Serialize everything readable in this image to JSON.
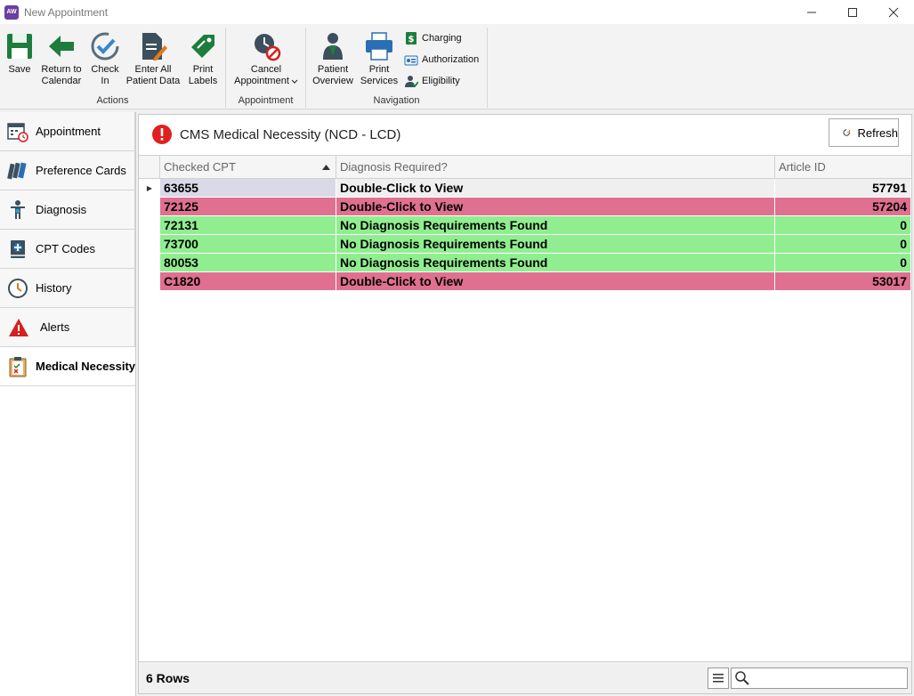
{
  "window": {
    "title": "New Appointment",
    "logo_text": "AW"
  },
  "ribbon": {
    "actions": {
      "label": "Actions",
      "save": "Save",
      "return_line1": "Return to",
      "return_line2": "Calendar",
      "checkin_line1": "Check",
      "checkin_line2": "In",
      "enter_line1": "Enter All",
      "enter_line2": "Patient Data",
      "print_line1": "Print",
      "print_line2": "Labels"
    },
    "appointment": {
      "label": "Appointment",
      "cancel_line1": "Cancel",
      "cancel_line2": "Appointment"
    },
    "navigation": {
      "label": "Navigation",
      "overview_line1": "Patient",
      "overview_line2": "Overview",
      "services_line1": "Print",
      "services_line2": "Services",
      "charging": "Charging",
      "authorization": "Authorization",
      "eligibility": "Eligibility"
    }
  },
  "sidebar": {
    "items": [
      {
        "label": "Appointment"
      },
      {
        "label": "Preference Cards"
      },
      {
        "label": "Diagnosis"
      },
      {
        "label": "CPT Codes"
      },
      {
        "label": "History"
      },
      {
        "label": "Alerts"
      },
      {
        "label": "Medical Necessity"
      }
    ]
  },
  "panel": {
    "title": "CMS Medical Necessity (NCD - LCD)",
    "refresh_label": "Refresh"
  },
  "table": {
    "headers": [
      "Checked CPT",
      "Diagnosis Required?",
      "Article ID"
    ],
    "rows": [
      {
        "cpt": "63655",
        "diag": "Double-Click to View",
        "article": "57791"
      },
      {
        "cpt": "72125",
        "diag": "Double-Click to View",
        "article": "57204"
      },
      {
        "cpt": "72131",
        "diag": "No Diagnosis Requirements Found",
        "article": "0"
      },
      {
        "cpt": "73700",
        "diag": "No Diagnosis Requirements Found",
        "article": "0"
      },
      {
        "cpt": "80053",
        "diag": "No Diagnosis Requirements Found",
        "article": "0"
      },
      {
        "cpt": "C1820",
        "diag": "Double-Click to View",
        "article": "53017"
      }
    ]
  },
  "footer": {
    "rows_label": "6 Rows"
  },
  "colors": {
    "pink_row": "#e07090",
    "green_row": "#90ee90",
    "selected_row": "#d9d9e8",
    "accent_red": "#e02020"
  }
}
